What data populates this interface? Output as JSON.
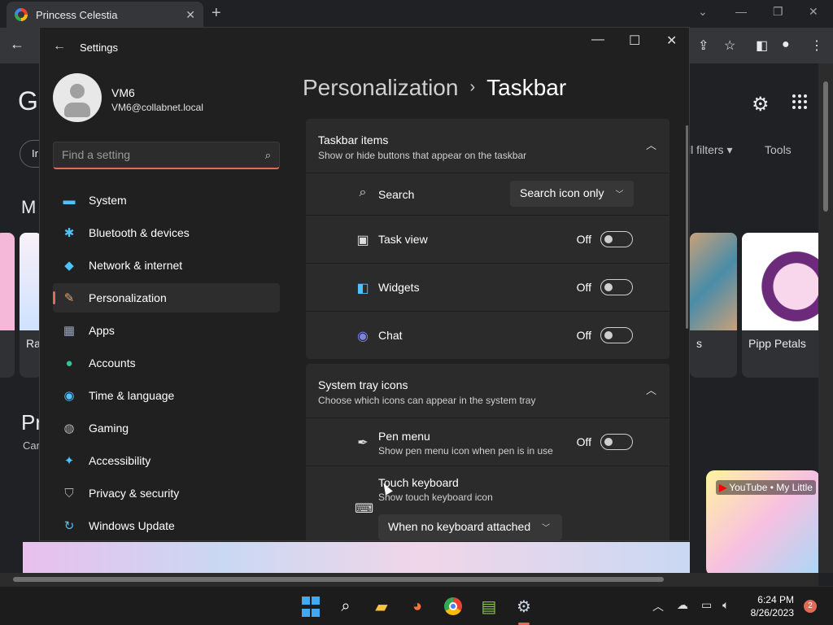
{
  "browser": {
    "tab_title": "Princess Celestia",
    "tab_close": "✕",
    "new_tab": "+",
    "page": {
      "logo_partial": "G",
      "chip_partial": "Ir",
      "filters": "ll filters ▾",
      "tools": "Tools",
      "section_partial": "M",
      "section2_partial": "Pr",
      "section2_sub_partial": "Car",
      "card_left_label": "Ra",
      "card_right_label": "Pipp Petals",
      "card_mid_label": "s",
      "youtube_label": "YouTube • My Little"
    }
  },
  "settings": {
    "title": "Settings",
    "user": {
      "name": "VM6",
      "email": "VM6@collabnet.local"
    },
    "search": {
      "placeholder": "Find a setting"
    },
    "nav": [
      {
        "label": "System",
        "icon": "system-icon",
        "glyph": "▭",
        "color": "#4cc2ff"
      },
      {
        "label": "Bluetooth & devices",
        "icon": "bluetooth-icon",
        "glyph": "✱",
        "color": "#4cc2ff"
      },
      {
        "label": "Network & internet",
        "icon": "wifi-icon",
        "glyph": "◆",
        "color": "#4cc2ff"
      },
      {
        "label": "Personalization",
        "icon": "brush-icon",
        "glyph": "✎",
        "color": "#f0a060"
      },
      {
        "label": "Apps",
        "icon": "apps-icon",
        "glyph": "▦",
        "color": "#9aa4b8"
      },
      {
        "label": "Accounts",
        "icon": "accounts-icon",
        "glyph": "●",
        "color": "#2fc4a0"
      },
      {
        "label": "Time & language",
        "icon": "globe-clock-icon",
        "glyph": "◉",
        "color": "#4cc2ff"
      },
      {
        "label": "Gaming",
        "icon": "gamepad-icon",
        "glyph": "◍",
        "color": "#b0b0b0"
      },
      {
        "label": "Accessibility",
        "icon": "accessibility-icon",
        "glyph": "✦",
        "color": "#4cc2ff"
      },
      {
        "label": "Privacy & security",
        "icon": "shield-icon",
        "glyph": "⛉",
        "color": "#b0b0b0"
      },
      {
        "label": "Windows Update",
        "icon": "update-icon",
        "glyph": "↻",
        "color": "#4cc2ff"
      }
    ],
    "active_nav": "Personalization",
    "breadcrumb": {
      "parent": "Personalization",
      "separator": "›",
      "current": "Taskbar"
    },
    "taskbar_items": {
      "title": "Taskbar items",
      "subtitle": "Show or hide buttons that appear on the taskbar",
      "search": {
        "label": "Search",
        "value": "Search icon only"
      },
      "task_view": {
        "label": "Task view",
        "state": "Off"
      },
      "widgets": {
        "label": "Widgets",
        "state": "Off"
      },
      "chat": {
        "label": "Chat",
        "state": "Off"
      }
    },
    "system_tray": {
      "title": "System tray icons",
      "subtitle": "Choose which icons can appear in the system tray",
      "pen_menu": {
        "label": "Pen menu",
        "sub": "Show pen menu icon when pen is in use",
        "state": "Off"
      },
      "touch_keyboard": {
        "label": "Touch keyboard",
        "sub": "Show touch keyboard icon",
        "value": "When no keyboard attached"
      }
    }
  },
  "taskbar": {
    "time": "6:24 PM",
    "date": "8/26/2023",
    "notification_count": "2",
    "apps": [
      "start-icon",
      "search-icon",
      "file-explorer-icon",
      "firefox-icon",
      "chrome-icon",
      "notepad-icon",
      "settings-gear-icon"
    ]
  }
}
